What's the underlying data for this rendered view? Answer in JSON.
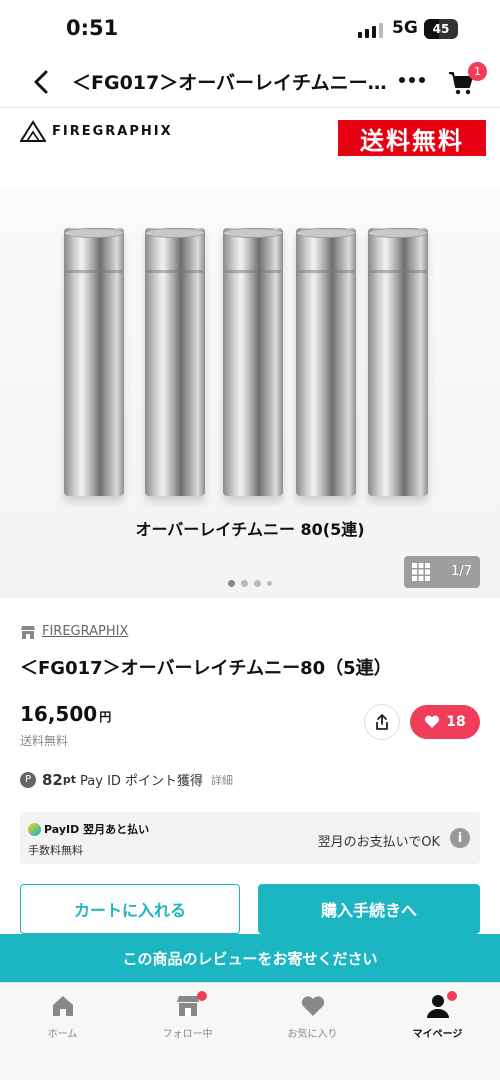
{
  "status_bar": {
    "time": "0:51",
    "network": "5G",
    "battery_level": "45",
    "battery_fraction": 0.45
  },
  "nav": {
    "title": "＜FG017＞オーバーレイチムニー…",
    "cart_badge": "1"
  },
  "hero": {
    "brand_logo_text": "FIREGRAPHIX",
    "free_shipping_banner": "送料無料",
    "photo_caption": "オーバーレイチムニー 80(5連)",
    "image_counter": "1/7",
    "dot_count": 4,
    "active_dot": 1
  },
  "product": {
    "shop_name": "FIREGRAPHIX",
    "title": "＜FG017＞オーバーレイチムニー80（5連）",
    "price": "16,500",
    "price_unit": "円",
    "shipping_note": "送料無料",
    "like_count": "18"
  },
  "points": {
    "amount": "82",
    "unit": "pt",
    "label": "Pay ID ポイント獲得",
    "detail_link": "詳細"
  },
  "payid": {
    "logo_text": "PayID 翌月あと払い",
    "fee_text": "手数料無料",
    "ok_text": "翌月のお支払いでOK",
    "info_glyph": "i"
  },
  "actions": {
    "add_to_cart": "カートに入れる",
    "checkout": "購入手続きへ",
    "review_banner": "この商品のレビューをお寄せください"
  },
  "tabbar": {
    "items": [
      {
        "label": "ホーム",
        "icon": "home-icon",
        "badge": false,
        "active": false
      },
      {
        "label": "フォロー中",
        "icon": "store-icon",
        "badge": true,
        "active": false
      },
      {
        "label": "お気に入り",
        "icon": "heart-icon",
        "badge": false,
        "active": false
      },
      {
        "label": "マイページ",
        "icon": "person-icon",
        "badge": true,
        "active": true
      }
    ]
  },
  "colors": {
    "accent_teal": "#1bb6c1",
    "like_pink": "#ef3d5a",
    "free_ship_red": "#e60012"
  }
}
